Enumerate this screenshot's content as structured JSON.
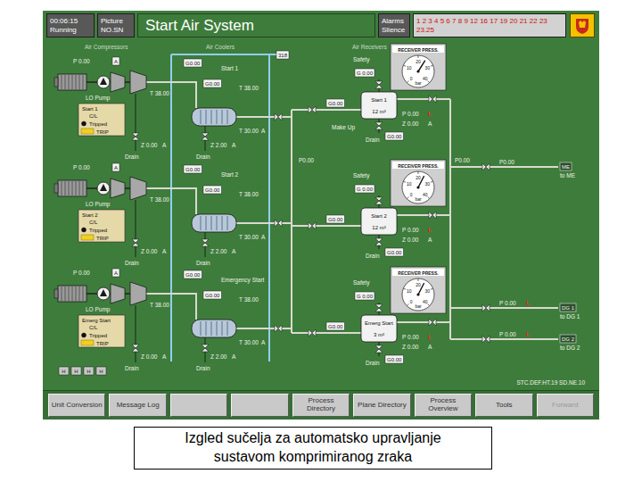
{
  "header": {
    "clock": "00:06:15",
    "mode": "Running",
    "picture_label": "Picture",
    "picture_no": "NO.SN",
    "title": "Start Air System",
    "alarms_label": "Alarms",
    "silence_label": "Silence",
    "alarm_numbers": "1 2 3 4 5 6 7 8 9 12 16 17 19 20 21 22 23",
    "silence_value": "23.25"
  },
  "sections": {
    "compressors": "Air Compressors",
    "coolers": "Air Coolers",
    "receivers": "Air Receivers"
  },
  "main_tag": "318",
  "trains": [
    {
      "compressor": {
        "pressure": "P 0.00",
        "pressure_mode": "A",
        "pump": "LO Pump",
        "outlet_temp": "T 38.00",
        "running": false,
        "status": {
          "name": "Start 1",
          "control": "C/L",
          "tripped_label": "Tripped",
          "trip_label": "TRIP",
          "tripped": true
        }
      },
      "cooler": {
        "name": "Start 1",
        "flow_in": "G0.00",
        "flow_out": "G0.00",
        "temp_in": "T 38.00",
        "temp_out": "T 30.00",
        "temp_mode": "A",
        "level_comp": "Z 0.00",
        "level_comp_mode": "A",
        "level_cooler": "Z 2.00",
        "level_cooler_mode": "A",
        "drain_comp": "Drain",
        "drain_cooler": "Drain"
      },
      "receiver": {
        "gauge_title": "RECEIVER PRESS.",
        "scale": [
          "0",
          "10",
          "20",
          "30",
          "40"
        ],
        "unit": "bar",
        "level": 0.62,
        "safety": "Safety",
        "safety_flow": "G 0.00",
        "inlet_flow": "G0.00",
        "name": "Start 1",
        "volume": "12 m³",
        "pressure": "P 0.00",
        "pressure_alarm": "L",
        "temperature": "Z 0.00",
        "temp_mode": "A",
        "make_up": "Make Up",
        "drain": "Drain",
        "drain_flow": "G0.00"
      }
    },
    {
      "compressor": {
        "pressure": "P 0.00",
        "pressure_mode": "A",
        "pump": "LO Pump",
        "outlet_temp": "T 38.00",
        "running": false,
        "status": {
          "name": "Start 2",
          "control": "C/L",
          "tripped_label": "Tripped",
          "trip_label": "TRIP",
          "tripped": true
        }
      },
      "cooler": {
        "name": "Start 2",
        "flow_in": "G0.00",
        "flow_out": "G0.00",
        "temp_in": "T 38.00",
        "temp_out": "T 30.00",
        "temp_mode": "A",
        "level_comp": "Z 0.00",
        "level_comp_mode": "A",
        "level_cooler": "Z 2.00",
        "level_cooler_mode": "A",
        "drain_comp": "Drain",
        "drain_cooler": "Drain"
      },
      "receiver": {
        "gauge_title": "RECEIVER PRESS.",
        "scale": [
          "0",
          "10",
          "20",
          "30",
          "40"
        ],
        "unit": "bar",
        "level": 0.6,
        "safety": "Safety",
        "safety_flow": "G 0.00",
        "inlet_flow": "G0.00",
        "name": "Start 2",
        "volume": "12 m³",
        "pressure": "P 0.00",
        "pressure_alarm": "L",
        "temperature": "Z 0.00",
        "temp_mode": "A",
        "drain": "Drain",
        "drain_flow": "G0.00"
      }
    },
    {
      "compressor": {
        "pressure": "P 0.00",
        "pressure_mode": "A",
        "pump": "LO Pump",
        "outlet_temp": "T 38.00",
        "running": false,
        "status": {
          "name": "Emerg Start",
          "control": "C/L",
          "tripped_label": "Tripped",
          "trip_label": "TRIP",
          "tripped": true
        }
      },
      "cooler": {
        "name": "Emergency Start",
        "flow_in": "G0.00",
        "flow_out": "G0.00",
        "temp_in": "T 38.00",
        "temp_out": "T 30.00",
        "temp_mode": "A",
        "level_comp": "Z 0.00",
        "level_comp_mode": "A",
        "level_cooler": "Z 2.00",
        "level_cooler_mode": "A",
        "drain_comp": "Drain",
        "drain_cooler": "Drain"
      },
      "receiver": {
        "gauge_title": "RECEIVER PRESS.",
        "scale": [
          "0",
          "10",
          "20",
          "30",
          "40"
        ],
        "unit": "bar",
        "level": 0.6,
        "safety": "Safety",
        "safety_flow": "G 0.00",
        "inlet_flow": "G0.00",
        "name": "Emerg Start",
        "volume": "3 m³",
        "pressure": "P 0.00",
        "pressure_alarm": "L",
        "temperature": "Z 0.00",
        "temp_mode": "A",
        "drain": "Drain",
        "drain_flow": "G0.00"
      }
    }
  ],
  "junctions": [
    "P0.00",
    "P0.00"
  ],
  "consumers": [
    {
      "pressure": "P0.00",
      "dest": "ME",
      "dest_sub": "to ME"
    },
    {
      "pressure": "P 0.00",
      "alarm": "L",
      "dest": "DG 1",
      "dest_sub": "to DG 1"
    },
    {
      "pressure": "P 0.00",
      "alarm": "L",
      "dest": "DG 2",
      "dest_sub": "to DG 2"
    }
  ],
  "lamp_test": [
    "H",
    "H",
    "H",
    "H"
  ],
  "sys_tag": "STC.DEF.HT.19  SD.NE.10",
  "buttons": [
    {
      "label": "Unit Conversion",
      "disabled": false
    },
    {
      "label": "Message Log",
      "disabled": false
    },
    {
      "label": "",
      "disabled": false
    },
    {
      "label": "",
      "disabled": false
    },
    {
      "label": "Process Directory",
      "disabled": false
    },
    {
      "label": "Plane Directory",
      "disabled": false
    },
    {
      "label": "Process Overview",
      "disabled": false
    },
    {
      "label": "Tools",
      "disabled": false
    },
    {
      "label": "Forward",
      "disabled": true
    }
  ],
  "caption": [
    "Izgled sučelja za automatsko upravljanje",
    "sustavom komprimiranog zraka"
  ]
}
